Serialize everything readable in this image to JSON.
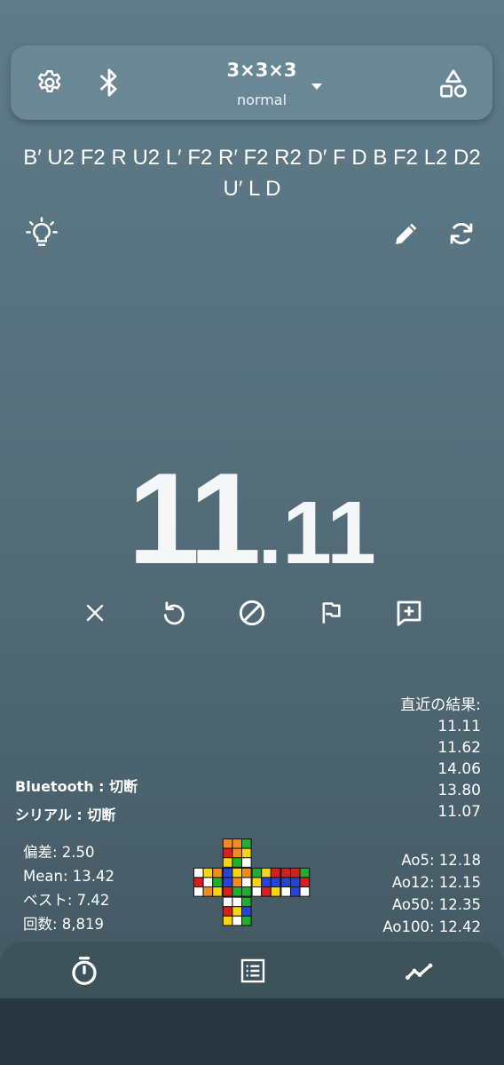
{
  "header": {
    "settings_icon": "gear-icon",
    "bluetooth_icon": "bluetooth-icon",
    "puzzle": "3×3×3",
    "category": "normal",
    "dropdown_icon": "caret-down-icon",
    "shapes_icon": "shapes-icon"
  },
  "scramble": "B′ U2 F2 R U2 L′ F2 R′ F2 R2 D′ F D B F2 L2 D2 U′ L D",
  "tools": {
    "hint_icon": "lightbulb-icon",
    "edit_icon": "pencil-icon",
    "refresh_icon": "refresh-icon"
  },
  "timer": {
    "seconds": "11",
    "centis": ".11"
  },
  "actions": [
    "close-icon",
    "undo-icon",
    "dnf-icon",
    "flag-icon",
    "add-comment-icon"
  ],
  "recent": {
    "title": "直近の結果:",
    "values": [
      "11.11",
      "11.62",
      "14.06",
      "13.80",
      "11.07"
    ]
  },
  "connection": {
    "bluetooth": "Bluetooth : 切断",
    "serial": "シリアル : 切断"
  },
  "stats_left": {
    "deviation": "偏差: 2.50",
    "mean": "Mean: 13.42",
    "best": "ベスト: 7.42",
    "count": "回数: 8,819"
  },
  "stats_right": {
    "ao5": "Ao5: 12.18",
    "ao12": "Ao12: 12.15",
    "ao50": "Ao50: 12.35",
    "ao100": "Ao100: 12.42"
  },
  "cube_net": {
    "colors": {
      "W": "#ffffff",
      "Y": "#f5d60f",
      "R": "#d81e1e",
      "O": "#f58a1f",
      "B": "#2545d8",
      "G": "#1fae2e"
    },
    "U": [
      [
        "O",
        "O",
        "G"
      ],
      [
        "R",
        "O",
        "Y"
      ],
      [
        "Y",
        "G",
        "W"
      ]
    ],
    "L": [
      [
        "W",
        "Y",
        "O"
      ],
      [
        "R",
        "W",
        "G"
      ],
      [
        "W",
        "O",
        "Y"
      ]
    ],
    "F": [
      [
        "B",
        "Y",
        "O"
      ],
      [
        "B",
        "O",
        "W"
      ],
      [
        "R",
        "G",
        "G"
      ]
    ],
    "R": [
      [
        "G",
        "Y",
        "R"
      ],
      [
        "Y",
        "B",
        "B"
      ],
      [
        "W",
        "R",
        "Y"
      ]
    ],
    "B": [
      [
        "R",
        "R",
        "G"
      ],
      [
        "B",
        "B",
        "R"
      ],
      [
        "W",
        "B",
        "W"
      ]
    ],
    "D": [
      [
        "W",
        "W",
        "G"
      ],
      [
        "R",
        "Y",
        "B"
      ],
      [
        "Y",
        "W",
        "G"
      ]
    ]
  },
  "nav": [
    "timer-icon",
    "list-icon",
    "chart-icon"
  ]
}
